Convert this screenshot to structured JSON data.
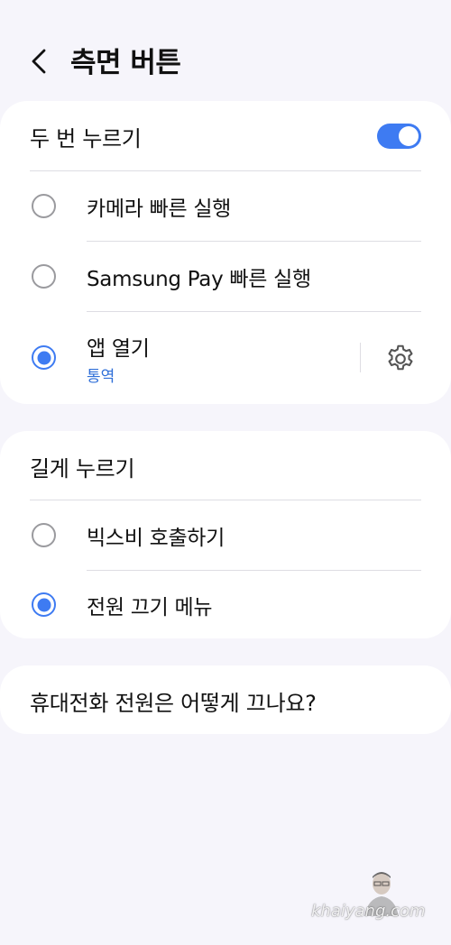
{
  "header": {
    "back_icon": "chevron-left-icon",
    "title": "측면 버튼"
  },
  "double_press": {
    "title": "두 번 누르기",
    "toggle_on": true,
    "accent_color": "#3e7bf2",
    "options": [
      {
        "label": "카메라 빠른 실행",
        "selected": false
      },
      {
        "label": "Samsung Pay 빠른 실행",
        "selected": false
      },
      {
        "label": "앱 열기",
        "sublabel": "통역",
        "selected": true,
        "settings_icon": "gear-icon"
      }
    ]
  },
  "press_and_hold": {
    "title": "길게 누르기",
    "options": [
      {
        "label": "빅스비 호출하기",
        "selected": false
      },
      {
        "label": "전원 끄기 메뉴",
        "selected": true
      }
    ]
  },
  "help": {
    "label": "휴대전화 전원은 어떻게 끄나요?"
  },
  "watermark": {
    "text": "khaiyang.com"
  }
}
